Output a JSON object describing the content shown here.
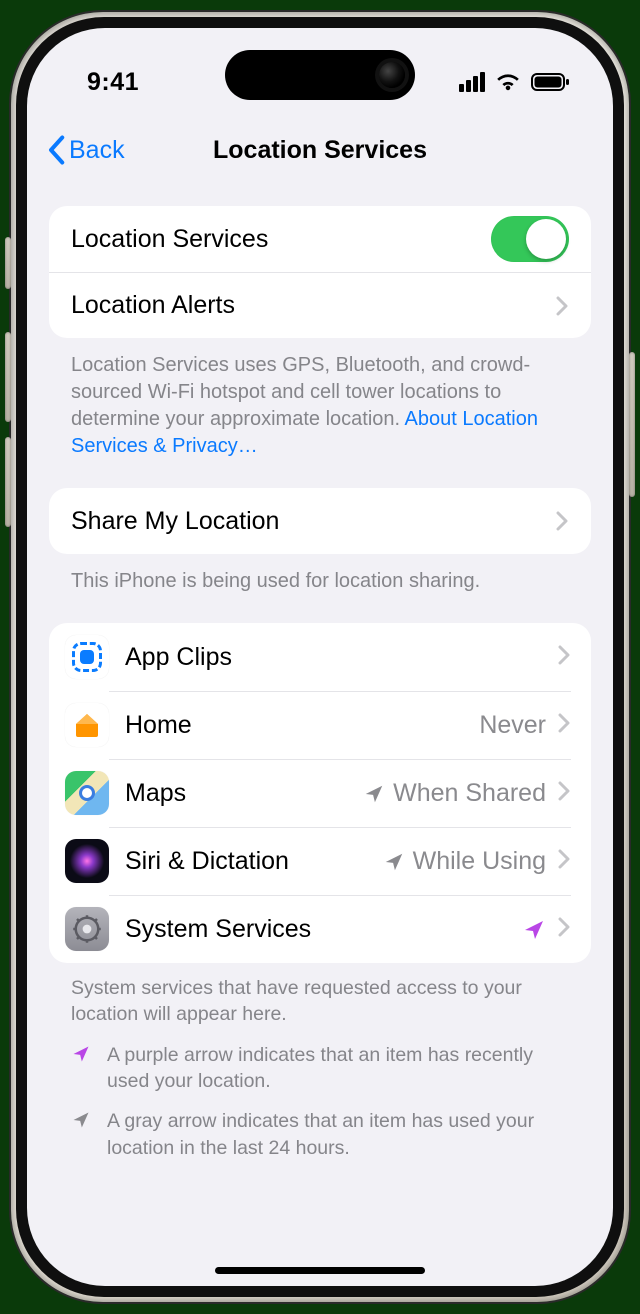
{
  "status": {
    "time": "9:41"
  },
  "nav": {
    "back": "Back",
    "title": "Location Services"
  },
  "group1": {
    "row0": {
      "label": "Location Services",
      "on": true
    },
    "row1": {
      "label": "Location Alerts"
    }
  },
  "footer1": {
    "text": "Location Services uses GPS, Bluetooth, and crowd-sourced Wi-Fi hotspot and cell tower locations to determine your approximate location. ",
    "link": "About Location Services & Privacy…"
  },
  "group2": {
    "row0": {
      "label": "Share My Location"
    }
  },
  "footer2": "This iPhone is being used for location sharing.",
  "apps": {
    "items": [
      {
        "name": "App Clips",
        "value": "",
        "arrow": ""
      },
      {
        "name": "Home",
        "value": "Never",
        "arrow": ""
      },
      {
        "name": "Maps",
        "value": "When Shared",
        "arrow": "gray"
      },
      {
        "name": "Siri & Dictation",
        "value": "While Using",
        "arrow": "gray"
      },
      {
        "name": "System Services",
        "value": "",
        "arrow": "purple"
      }
    ]
  },
  "footer3": "System services that have requested access to your location will appear here.",
  "legend": {
    "purple": "A purple arrow indicates that an item has recently used your location.",
    "gray": "A gray arrow indicates that an item has used your location in the last 24 hours."
  }
}
